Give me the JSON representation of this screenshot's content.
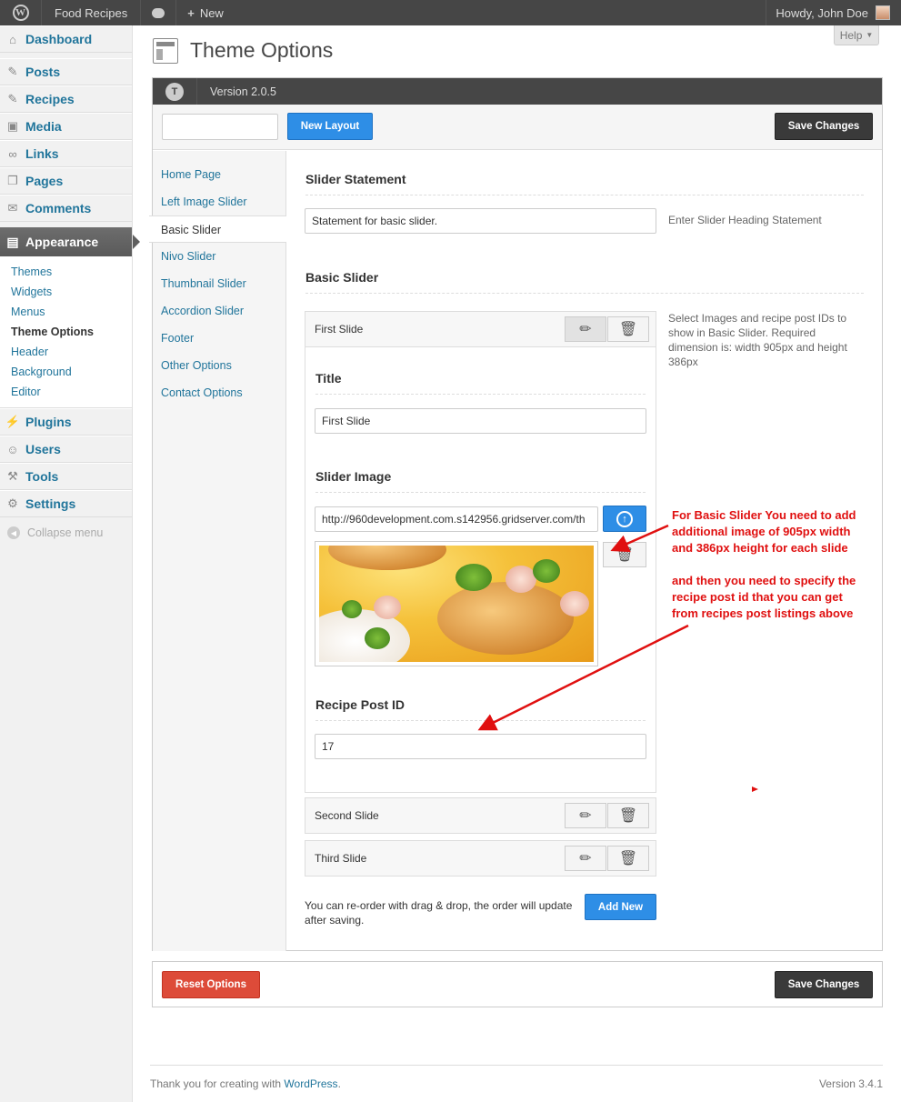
{
  "adminbar": {
    "site_name": "Food Recipes",
    "new_label": "New",
    "greeting": "Howdy, John Doe"
  },
  "sidebar": {
    "items": [
      {
        "label": "Dashboard",
        "icon": "dashboard-icon"
      },
      {
        "label": "Posts",
        "icon": "pushpin-icon"
      },
      {
        "label": "Recipes",
        "icon": "pushpin-icon"
      },
      {
        "label": "Media",
        "icon": "media-icon"
      },
      {
        "label": "Links",
        "icon": "link-icon"
      },
      {
        "label": "Pages",
        "icon": "pages-icon"
      },
      {
        "label": "Comments",
        "icon": "comment-icon"
      }
    ],
    "appearance": "Appearance",
    "submenu": [
      "Themes",
      "Widgets",
      "Menus",
      "Theme Options",
      "Header",
      "Background",
      "Editor"
    ],
    "items_after": [
      {
        "label": "Plugins",
        "icon": "plug-icon"
      },
      {
        "label": "Users",
        "icon": "users-icon"
      },
      {
        "label": "Tools",
        "icon": "tools-icon"
      },
      {
        "label": "Settings",
        "icon": "settings-icon"
      }
    ],
    "collapse": "Collapse menu"
  },
  "page": {
    "title": "Theme Options",
    "help": "Help"
  },
  "panel": {
    "version": "Version 2.0.5",
    "new_layout": "New Layout",
    "save_changes": "Save Changes",
    "reset_options": "Reset Options"
  },
  "options_nav": [
    "Home Page",
    "Left Image Slider",
    "Basic Slider",
    "Nivo Slider",
    "Thumbnail Slider",
    "Accordion Slider",
    "Footer",
    "Other Options",
    "Contact Options"
  ],
  "content": {
    "statement_heading": "Slider Statement",
    "statement_value": "Statement for basic slider.",
    "statement_desc": "Enter Slider Heading Statement",
    "slider_heading": "Basic Slider",
    "slider_desc": "Select Images and recipe post IDs to show in Basic Slider. Required dimension is: width 905px and height 386px",
    "slides": [
      "First Slide",
      "Second Slide",
      "Third Slide"
    ],
    "title_label": "Title",
    "title_value": "First Slide",
    "image_label": "Slider Image",
    "image_url": "http://960development.com.s142956.gridserver.com/th",
    "post_id_label": "Recipe Post ID",
    "post_id_value": "17",
    "reorder_note": "You can re-order with drag & drop, the order will update after saving.",
    "add_new": "Add New"
  },
  "annotation": {
    "line1": "For Basic Slider You need to add",
    "line2": "additional image of 905px width",
    "line3": "and 386px height for each slide",
    "line4": "and then you need to specify the",
    "line5": "recipe post id that you can get",
    "line6": "from recipes post listings above"
  },
  "footer": {
    "thanks": "Thank you for creating with",
    "link": "WordPress",
    "version": "Version 3.4.1"
  },
  "colors": {
    "link": "#21759b",
    "primary_button": "#2e8ee6",
    "danger_button": "#dd4b39",
    "annotation": "#e01010"
  }
}
